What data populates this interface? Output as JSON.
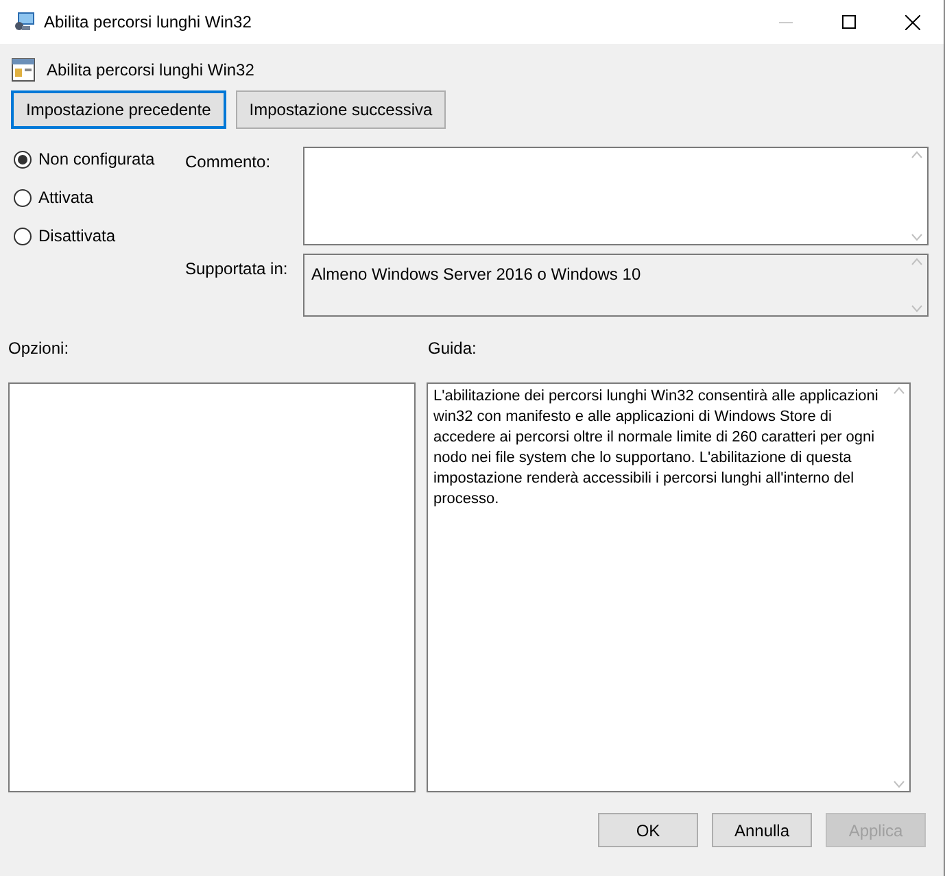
{
  "window": {
    "title": "Abilita percorsi lunghi Win32"
  },
  "header": {
    "title": "Abilita percorsi lunghi Win32"
  },
  "nav_buttons": [
    {
      "label": "Impostazione precedente",
      "focused": true
    },
    {
      "label": "Impostazione successiva",
      "focused": false
    }
  ],
  "state_options": [
    {
      "label": "Non configurata",
      "selected": true
    },
    {
      "label": "Attivata",
      "selected": false
    },
    {
      "label": "Disattivata",
      "selected": false
    }
  ],
  "comment": {
    "label": "Commento:"
  },
  "supported": {
    "label": "Supportata in:",
    "value": "Almeno Windows Server 2016 o Windows 10"
  },
  "options": {
    "label": "Opzioni:"
  },
  "help": {
    "label": "Guida:",
    "text": "L'abilitazione dei percorsi lunghi Win32 consentirà alle applicazioni win32 con manifesto e alle applicazioni di Windows Store di accedere ai percorsi oltre il normale limite di 260 caratteri per ogni nodo nei file system che lo supportano. L'abilitazione di questa impostazione renderà accessibili i percorsi lunghi all'interno del processo."
  },
  "buttons": [
    {
      "label": "OK",
      "disabled": false
    },
    {
      "label": "Annulla",
      "disabled": false
    },
    {
      "label": "Applica",
      "disabled": true
    }
  ]
}
